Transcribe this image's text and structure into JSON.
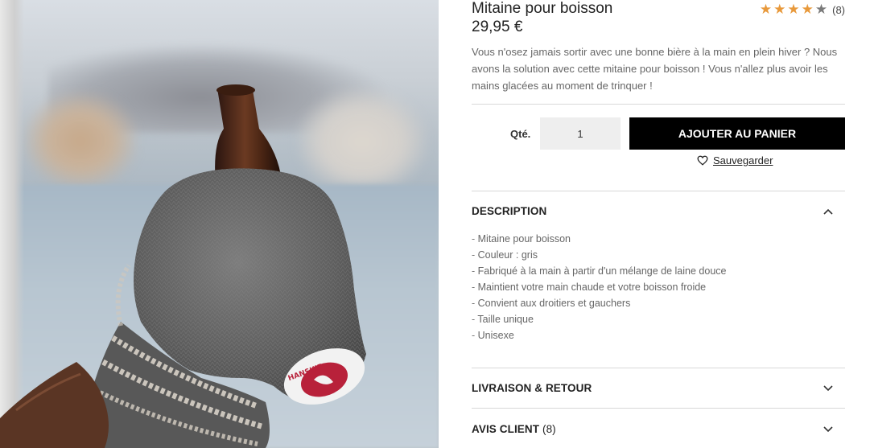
{
  "product": {
    "title": "Mitaine pour boisson",
    "price": "29,95 €",
    "rating": {
      "value": 4,
      "max": 5,
      "count_label": "(8)"
    },
    "description": "Vous n'osez jamais sortir avec une bonne bière à la main en plein hiver ? Nous avons la solution avec cette mitaine pour boisson ! Vous n'allez plus avoir les mains glacées au moment de trinquer !",
    "image_alt": "Mitaine en laine grise tenant une bouteille de bière",
    "logo_text": "HANSKIE"
  },
  "purchase": {
    "qty_label": "Qté.",
    "qty_value": "1",
    "add_to_cart": "AJOUTER AU PANIER",
    "save_label": "Sauvegarder"
  },
  "accordion": {
    "description": {
      "title": "DESCRIPTION",
      "expanded": true,
      "items": [
        "Mitaine pour boisson",
        "Couleur : gris",
        "Fabriqué à la main à partir d'un mélange de laine douce",
        "Maintient votre main chaude et votre boisson froide",
        "Convient aux droitiers et gauchers",
        "Taille unique",
        "Unisexe"
      ]
    },
    "shipping": {
      "title": "LIVRAISON & RETOUR",
      "expanded": false
    },
    "reviews": {
      "title": "AVIS CLIENT",
      "count": "(8)",
      "expanded": false
    }
  },
  "colors": {
    "star": "#e8993b",
    "star_off": "#7a7a7a",
    "button_bg": "#000000",
    "button_text": "#ffffff",
    "divider": "#d8d8d8"
  },
  "icons": {
    "star": "star-icon",
    "heart": "heart-icon",
    "chevron_up": "chevron-up-icon",
    "chevron_down": "chevron-down-icon"
  }
}
